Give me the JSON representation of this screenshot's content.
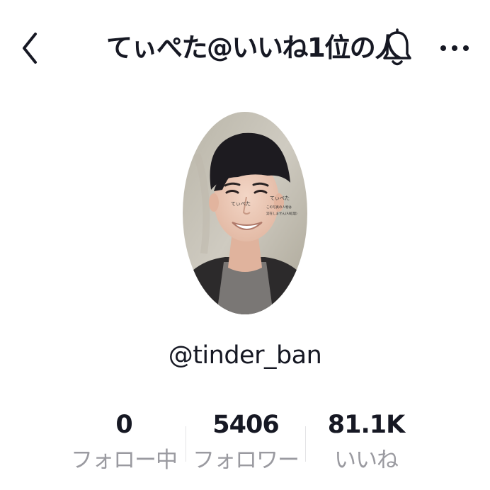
{
  "header": {
    "title": "てぃぺた@いいね1位の人",
    "back_icon": "chevron-left-icon",
    "bell_icon": "bell-icon",
    "more_icon": "more-dots-icon"
  },
  "profile": {
    "username": "@tinder_ban",
    "avatar": {
      "overlay_text_1": "てぃぺた",
      "overlay_text_2": "てぃぺた",
      "overlay_text_3": "この写真の人物は",
      "overlay_text_4": "実在しません(AI処理)"
    }
  },
  "stats": [
    {
      "value": "0",
      "label": "フォロー中"
    },
    {
      "value": "5406",
      "label": "フォロワー"
    },
    {
      "value": "81.1K",
      "label": "いいね"
    }
  ],
  "colors": {
    "text_primary": "#161823",
    "text_secondary": "#9a9aa0",
    "divider": "#e3e3e6",
    "background": "#ffffff"
  }
}
